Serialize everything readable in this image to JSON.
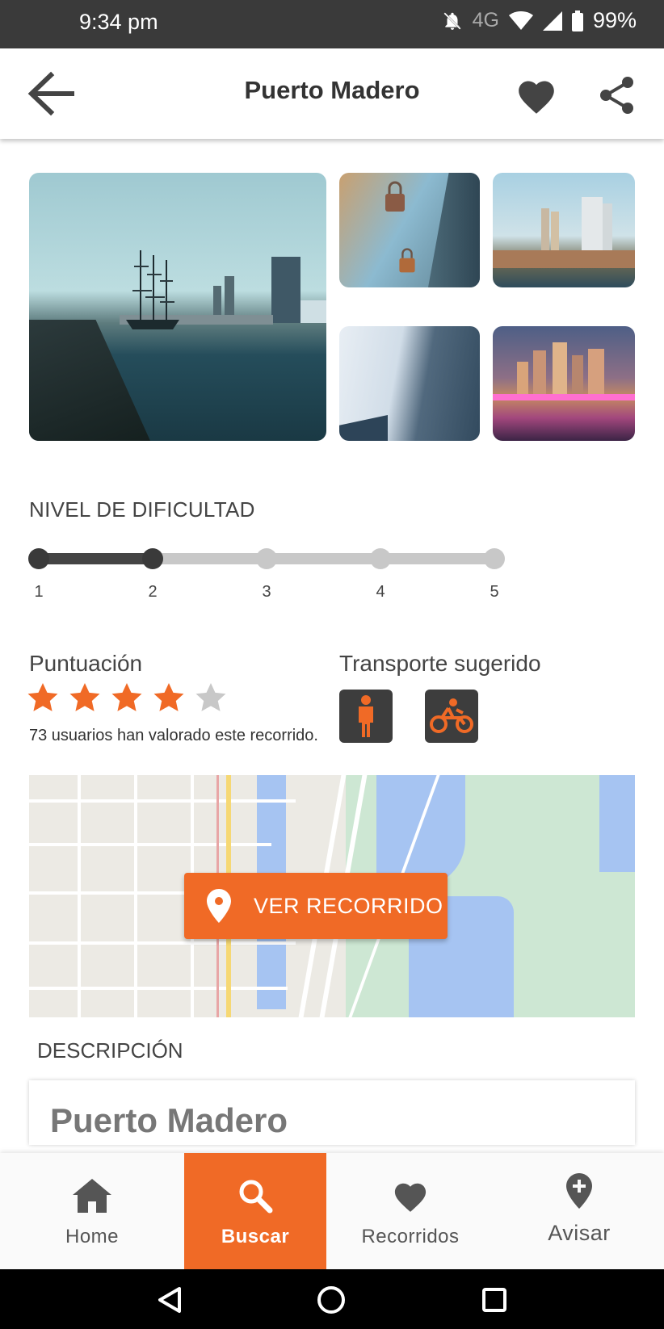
{
  "status_bar": {
    "time": "9:34 pm",
    "network": "4G",
    "battery": "99%"
  },
  "header": {
    "title": "Puerto Madero"
  },
  "gallery": {
    "images": [
      "harbor-icon",
      "love-locks-icon",
      "skyline-icon",
      "glass-tower-icon",
      "night-skyline-icon"
    ]
  },
  "difficulty": {
    "title": "NIVEL DE DIFICULTAD",
    "levels": [
      "1",
      "2",
      "3",
      "4",
      "5"
    ],
    "selected": 2
  },
  "rating": {
    "title": "Puntuación",
    "stars": 4,
    "max_stars": 5,
    "count_text": "73 usuarios han valorado este recorrido."
  },
  "transport": {
    "title": "Transporte sugerido",
    "options": [
      "walking-icon",
      "motorcycle-icon"
    ]
  },
  "map": {
    "button_label": "VER RECORRIDO"
  },
  "description": {
    "title": "DESCRIPCIÓN",
    "card_title": "Puerto Madero"
  },
  "bottom_nav": {
    "items": [
      {
        "label": "Home",
        "icon": "home-icon"
      },
      {
        "label": "Buscar",
        "icon": "search-icon"
      },
      {
        "label": "Recorridos",
        "icon": "heart-icon"
      },
      {
        "label": "Avisar",
        "icon": "location-add-icon"
      }
    ],
    "active": 1
  },
  "colors": {
    "accent": "#f06a26",
    "dark": "#3d3d3d",
    "track_inactive": "#c8c8c8"
  }
}
